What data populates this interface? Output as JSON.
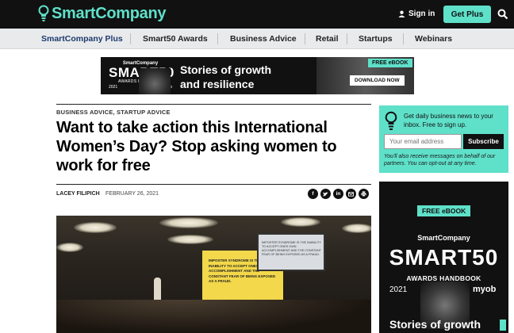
{
  "header": {
    "logo_text": "SmartCompany",
    "signin_label": "Sign in",
    "getplus_label": "Get Plus",
    "accent_color": "#5fe0c9"
  },
  "nav": {
    "items": [
      "SmartCompany Plus",
      "Smart50 Awards",
      "Business Advice",
      "Retail",
      "Startups",
      "Webinars"
    ]
  },
  "banner": {
    "handbook_brand": "SmartCompany",
    "handbook_big": "SMART50",
    "handbook_sub": "AWARDS HANDBOOK",
    "handbook_year": "2021",
    "handbook_partner": "myob",
    "headline_line1": "Stories of growth",
    "headline_line2": "and resilience",
    "free_label": "FREE eBOOK",
    "download_label": "DOWNLOAD NOW"
  },
  "article": {
    "categories": "BUSINESS ADVICE, STARTUP ADVICE",
    "title": "Want to take action this International Women’s Day? Stop asking women to work for free",
    "author": "LACEY FILIPICH",
    "date": "FEBRUARY 26, 2021",
    "share_icons": [
      "facebook-icon",
      "twitter-icon",
      "linkedin-icon",
      "email-icon",
      "print-icon"
    ],
    "hero_screen_text": "IMPOSTER SYNDROME IS THE INABILITY TO ACCEPT ONES OWN ACCOMPLISHMENT AND THE CONSTANT FEAR OF BEING EXPOSED AS A FRAUD.",
    "hero_monitor_text": "IMPOSTER SYNDROME IS THE INABILITY TO ACCEPT ONES OWN ACCOMPLISHMENT AND THE CONSTANT FEAR OF BEING EXPOSED AS A FRAUD."
  },
  "signup": {
    "text": "Get daily business news to your inbox. Free to sign up.",
    "email_placeholder": "Your email address",
    "subscribe_label": "Subscribe",
    "note": "You'll also receive messages on behalf of our partners. You can opt-out at any time."
  },
  "side_ad": {
    "free_label": "FREE eBOOK",
    "brand": "SmartCompany",
    "big": "SMART50",
    "sub": "AWARDS HANDBOOK",
    "year": "2021",
    "partner": "myob",
    "headline": "Stories of growth"
  }
}
